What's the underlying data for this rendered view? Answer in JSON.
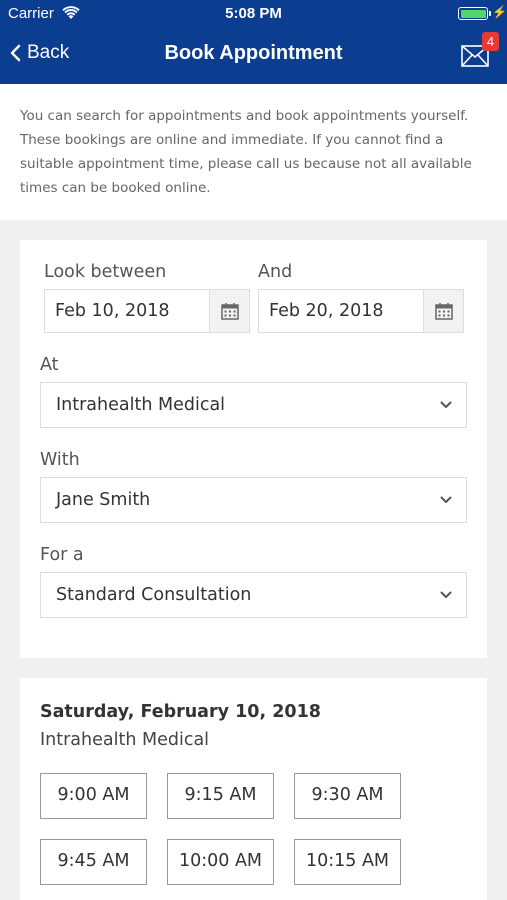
{
  "status_bar": {
    "carrier": "Carrier",
    "time": "5:08 PM",
    "battery_level": 1.0,
    "battery_color": "#4cd964"
  },
  "nav": {
    "back_label": "Back",
    "title": "Book Appointment",
    "mail_badge": "4",
    "mail_icon": "mail-icon"
  },
  "intro_text": "You can search for appointments and book appointments yourself. These bookings are online and immediate. If you cannot find a suitable appointment time, please call us because not all available times can be booked online.",
  "form": {
    "look_between_label": "Look between",
    "start_date": "Feb 10, 2018",
    "and_label": "And",
    "end_date": "Feb 20, 2018",
    "at_label": "At",
    "at_value": "Intrahealth Medical",
    "with_label": "With",
    "with_value": "Jane Smith",
    "for_label": "For a",
    "for_value": "Standard Consultation"
  },
  "slots": {
    "date": "Saturday, February 10, 2018",
    "location": "Intrahealth Medical",
    "times": [
      "9:00 AM",
      "9:15 AM",
      "9:30 AM",
      "9:45 AM",
      "10:00 AM",
      "10:15 AM"
    ]
  }
}
